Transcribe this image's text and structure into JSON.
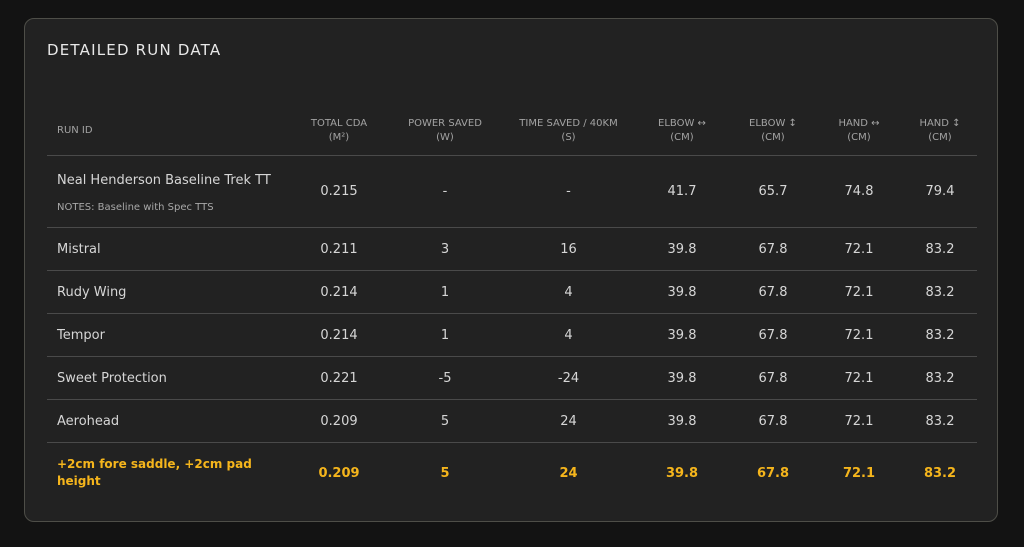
{
  "title": "DETAILED RUN DATA",
  "columns": [
    {
      "line1": "RUN ID",
      "line2": ""
    },
    {
      "line1": "TOTAL CDA",
      "line2": "(M²)"
    },
    {
      "line1": "POWER SAVED",
      "line2": "(W)"
    },
    {
      "line1": "TIME SAVED / 40KM",
      "line2": "(S)"
    },
    {
      "line1": "ELBOW ↔",
      "line2": "(CM)"
    },
    {
      "line1": "ELBOW ↕",
      "line2": "(CM)"
    },
    {
      "line1": "HAND ↔",
      "line2": "(CM)"
    },
    {
      "line1": "HAND ↕",
      "line2": "(CM)"
    }
  ],
  "rows": [
    {
      "run_id": "Neal Henderson Baseline Trek TT",
      "notes": "NOTES: Baseline with Spec TTS",
      "cda": "0.215",
      "power": "-",
      "time": "-",
      "elbow_h": "41.7",
      "elbow_v": "65.7",
      "hand_h": "74.8",
      "hand_v": "79.4"
    },
    {
      "run_id": "Mistral",
      "cda": "0.211",
      "power": "3",
      "time": "16",
      "elbow_h": "39.8",
      "elbow_v": "67.8",
      "hand_h": "72.1",
      "hand_v": "83.2"
    },
    {
      "run_id": "Rudy Wing",
      "cda": "0.214",
      "power": "1",
      "time": "4",
      "elbow_h": "39.8",
      "elbow_v": "67.8",
      "hand_h": "72.1",
      "hand_v": "83.2"
    },
    {
      "run_id": "Tempor",
      "cda": "0.214",
      "power": "1",
      "time": "4",
      "elbow_h": "39.8",
      "elbow_v": "67.8",
      "hand_h": "72.1",
      "hand_v": "83.2"
    },
    {
      "run_id": "Sweet Protection",
      "cda": "0.221",
      "power": "-5",
      "time": "-24",
      "elbow_h": "39.8",
      "elbow_v": "67.8",
      "hand_h": "72.1",
      "hand_v": "83.2"
    },
    {
      "run_id": "Aerohead",
      "cda": "0.209",
      "power": "5",
      "time": "24",
      "elbow_h": "39.8",
      "elbow_v": "67.8",
      "hand_h": "72.1",
      "hand_v": "83.2"
    },
    {
      "run_id": "+2cm fore saddle, +2cm pad height",
      "cda": "0.209",
      "power": "5",
      "time": "24",
      "elbow_h": "39.8",
      "elbow_v": "67.8",
      "hand_h": "72.1",
      "hand_v": "83.2"
    }
  ],
  "colors": {
    "background": "#131313",
    "card": "#222222",
    "border": "#4e4e48",
    "highlight": "#f5b51c"
  }
}
